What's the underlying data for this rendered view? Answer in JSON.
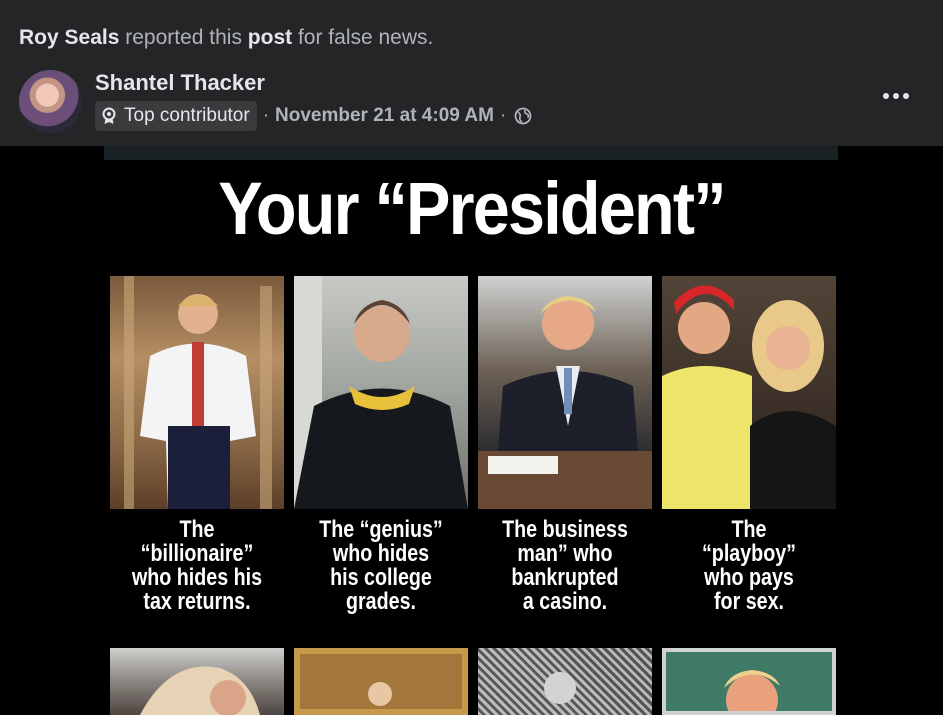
{
  "report": {
    "reporter": "Roy Seals",
    "text_before": " reported this ",
    "object": "post",
    "text_after": " for false news."
  },
  "post": {
    "author": "Shantel Thacker",
    "badge_label": "Top contributor",
    "separator": "·",
    "timestamp": "November 21 at 4:09 AM",
    "audience_icon": "globe-icon",
    "more_icon": "more-options-icon"
  },
  "image": {
    "headline": "Your “President”",
    "captions": [
      "The\n“billionaire”\nwho hides his\ntax returns.",
      "The “genius”\nwho hides\nhis college\ngrades.",
      "The business\nman” who\nbankrupted\na casino.",
      "The\n“playboy”\nwho pays\nfor sex."
    ]
  },
  "colors": {
    "background": "#242526",
    "text_primary": "#e4e6eb",
    "text_secondary": "#b0b3b8",
    "badge_bg": "#3a3b3c"
  }
}
